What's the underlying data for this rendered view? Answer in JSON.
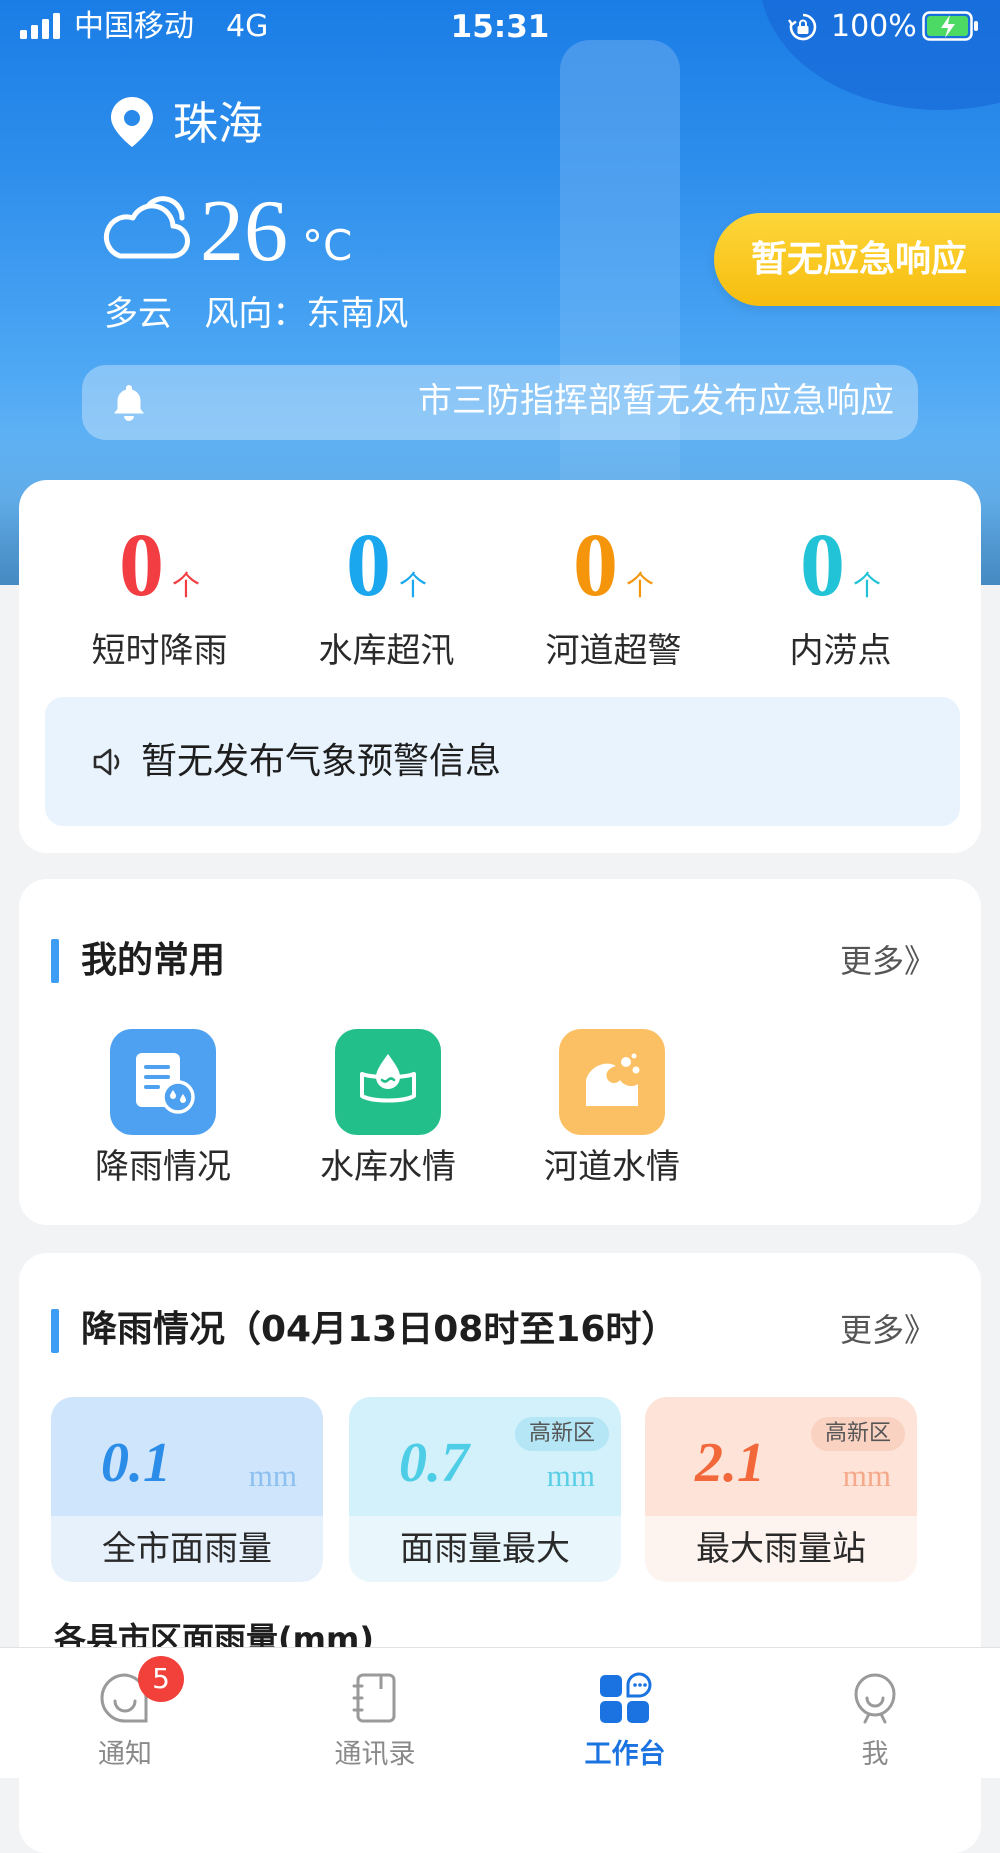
{
  "status_bar": {
    "carrier": "中国移动",
    "network": "4G",
    "time": "15:31",
    "battery": "100%",
    "battery_color": "#4cd964"
  },
  "header": {
    "city": "珠海",
    "weather_icon": "cloud-icon",
    "temperature": "26",
    "temperature_unit": "°C",
    "weather_line": "多云   风向：东南风",
    "response_button": "暂无应急响应",
    "notice": "市三防指挥部暂无发布应急响应"
  },
  "stats": [
    {
      "value": "0",
      "unit": "个",
      "label": "短时降雨",
      "color": "#f23d42"
    },
    {
      "value": "0",
      "unit": "个",
      "label": "水库超汛",
      "color": "#1aa7ee"
    },
    {
      "value": "0",
      "unit": "个",
      "label": "河道超警",
      "color": "#f4950c"
    },
    {
      "value": "0",
      "unit": "个",
      "label": "内涝点",
      "color": "#22c3d6"
    }
  ],
  "warning": {
    "icon": "speaker-icon",
    "text": "暂无发布气象预警信息"
  },
  "favorites": {
    "title": "我的常用",
    "more": "更多》",
    "items": [
      {
        "label": "降雨情况",
        "icon": "rain-report-icon",
        "color": "#4ea1f0"
      },
      {
        "label": "水库水情",
        "icon": "reservoir-icon",
        "color": "#23bf8a"
      },
      {
        "label": "河道水情",
        "icon": "river-wave-icon",
        "color": "#fcc064"
      }
    ]
  },
  "rainfall": {
    "title": "降雨情况（04月13日08时至16时）",
    "more": "更多》",
    "cards": [
      {
        "value": "0.1",
        "unit": "mm",
        "label": "全市面雨量",
        "badge": "",
        "value_color": "#2b8de8",
        "unit_color": "#8cc0f0",
        "top_bg": "#cfe5fb",
        "bottom_bg": "#e7f1fc"
      },
      {
        "value": "0.7",
        "unit": "mm",
        "label": "面雨量最大",
        "badge": "高新区",
        "value_color": "#4dcde6",
        "unit_color": "#5ccfe6",
        "top_bg": "#d2f1fb",
        "bottom_bg": "#e9f7fd",
        "badge_bg": "#b4e6f6"
      },
      {
        "value": "2.1",
        "unit": "mm",
        "label": "最大雨量站",
        "badge": "高新区",
        "value_color": "#f2683a",
        "unit_color": "#f6a98a",
        "top_bg": "#fde3d8",
        "bottom_bg": "#fdf3ef",
        "badge_bg": "#fad2c2"
      }
    ],
    "district_title": "各县市区面雨量(mm)"
  },
  "tabbar": {
    "active_color": "#1a73e0",
    "items": [
      {
        "label": "通知",
        "icon": "chat-bubble-icon",
        "badge": "5"
      },
      {
        "label": "通讯录",
        "icon": "contacts-book-icon"
      },
      {
        "label": "工作台",
        "icon": "workbench-grid-icon",
        "active": true
      },
      {
        "label": "我",
        "icon": "profile-icon"
      }
    ]
  }
}
